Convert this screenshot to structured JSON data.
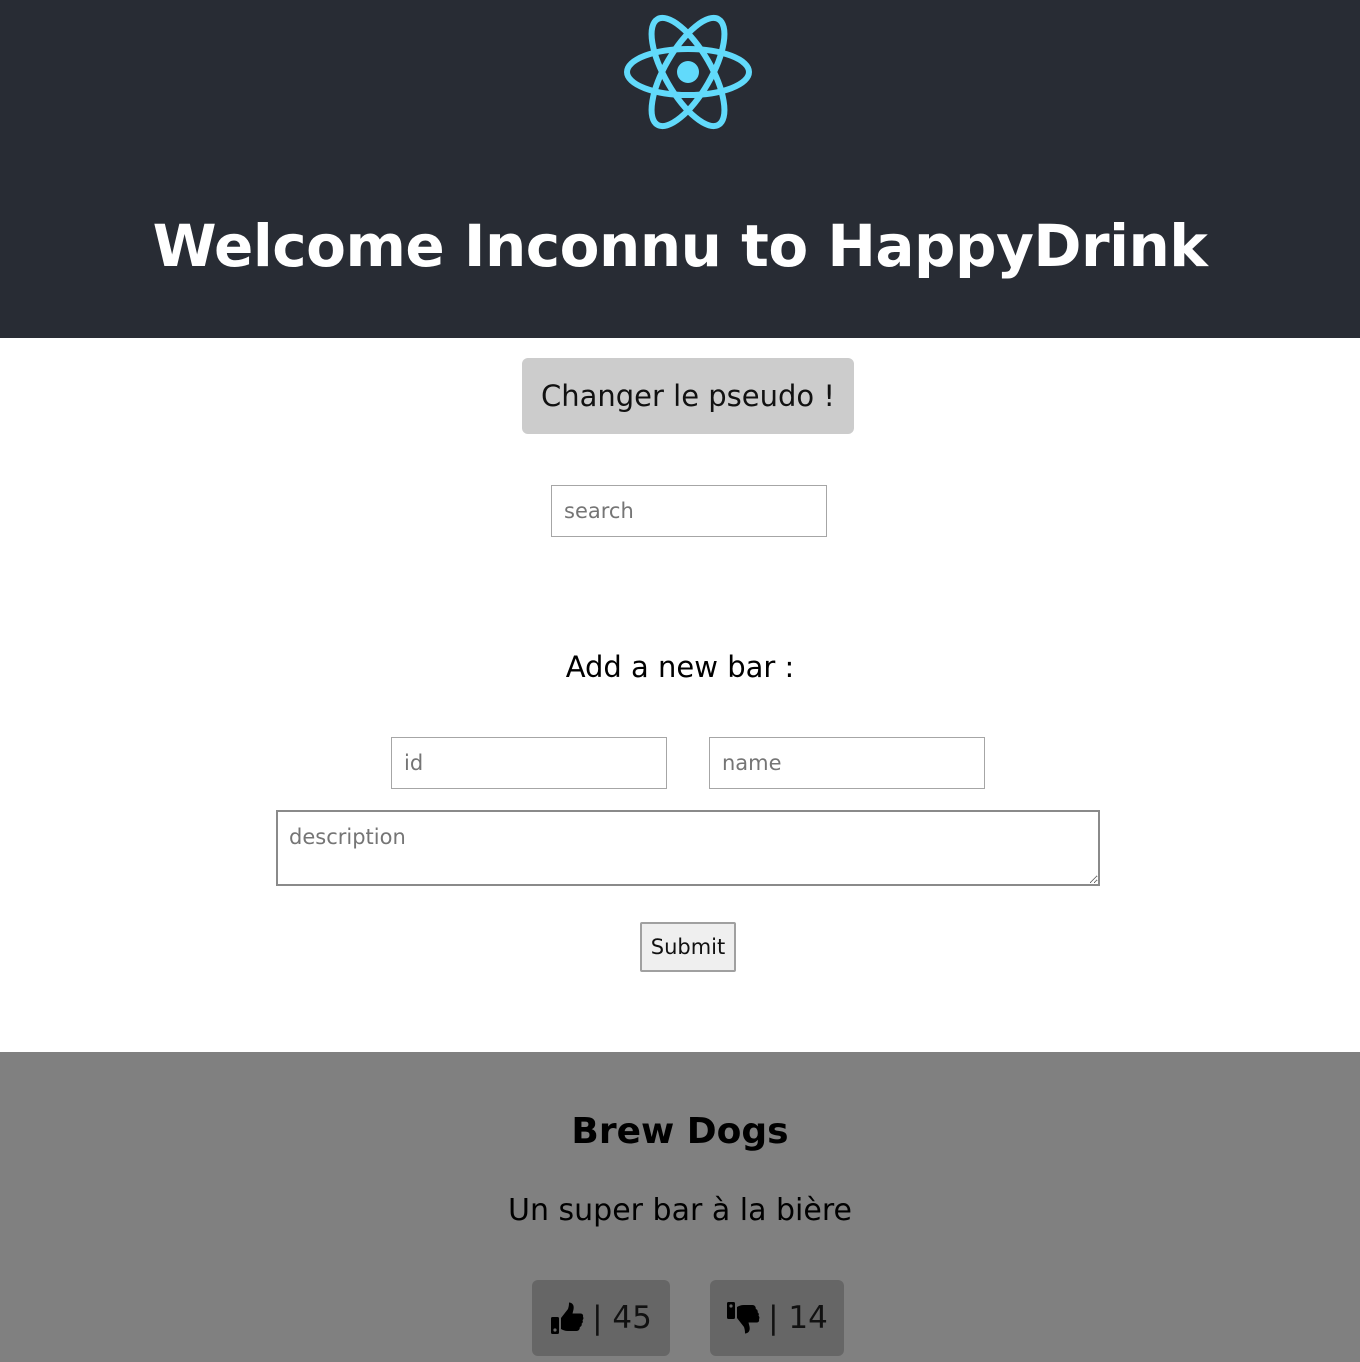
{
  "header": {
    "logo_icon": "react-atom-icon",
    "logo_color": "#61dafb",
    "title": "Welcome Inconnu to HappyDrink",
    "background": "#282c34"
  },
  "pseudo_button": {
    "label": "Changer le pseudo !"
  },
  "search": {
    "placeholder": "search",
    "value": ""
  },
  "add_bar_form": {
    "heading": "Add a new bar :",
    "id_placeholder": "id",
    "name_placeholder": "name",
    "description_placeholder": "description",
    "submit_label": "Submit"
  },
  "bars": [
    {
      "name": "Brew Dogs",
      "description": "Un super bar à la bière",
      "likes_icon": "thumbs-up-icon",
      "likes_label": "| 45",
      "dislikes_icon": "thumbs-down-icon",
      "dislikes_label": "| 14"
    }
  ]
}
